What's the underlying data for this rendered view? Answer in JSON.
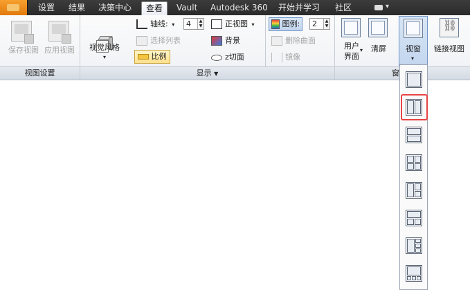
{
  "tabs": [
    {
      "label": "设置"
    },
    {
      "label": "结果"
    },
    {
      "label": "决策中心"
    },
    {
      "label": "查看",
      "active": true
    },
    {
      "label": "Vault"
    },
    {
      "label": "Autodesk 360"
    },
    {
      "label": "开始并学习"
    },
    {
      "label": "社区"
    }
  ],
  "panels": {
    "view_settings": {
      "title": "视图设置",
      "save_view": "保存视图",
      "apply_view": "应用视图"
    },
    "display": {
      "title": "显示",
      "visual_style": "视觉风格",
      "axes_label": "轴线:",
      "axes_value": "4",
      "select_list": "选择列表",
      "scale": "比例",
      "front_view": "正视图",
      "background": "背景",
      "z_section": "z切面",
      "legend_label": "图例:",
      "legend_value": "2",
      "delete_section": "删除曲面",
      "mirror": "镜像"
    },
    "window": {
      "title": "窗",
      "user_interface_line1": "用户",
      "user_interface_line2": "界面",
      "clear_screen": "清屏",
      "viewport": "视窗",
      "link_views": "链接视图"
    }
  },
  "viewport_layouts": [
    {
      "name": "single"
    },
    {
      "name": "two-vertical",
      "selected": true
    },
    {
      "name": "two-horizontal"
    },
    {
      "name": "four-grid"
    },
    {
      "name": "three-left-split"
    },
    {
      "name": "three-bottom-split"
    },
    {
      "name": "three-right-stack"
    },
    {
      "name": "four-bottom-row"
    }
  ],
  "colors": {
    "tabbar": "#2a2a2a",
    "accent_orange": "#e27a0d",
    "selection_red": "#e84343"
  }
}
